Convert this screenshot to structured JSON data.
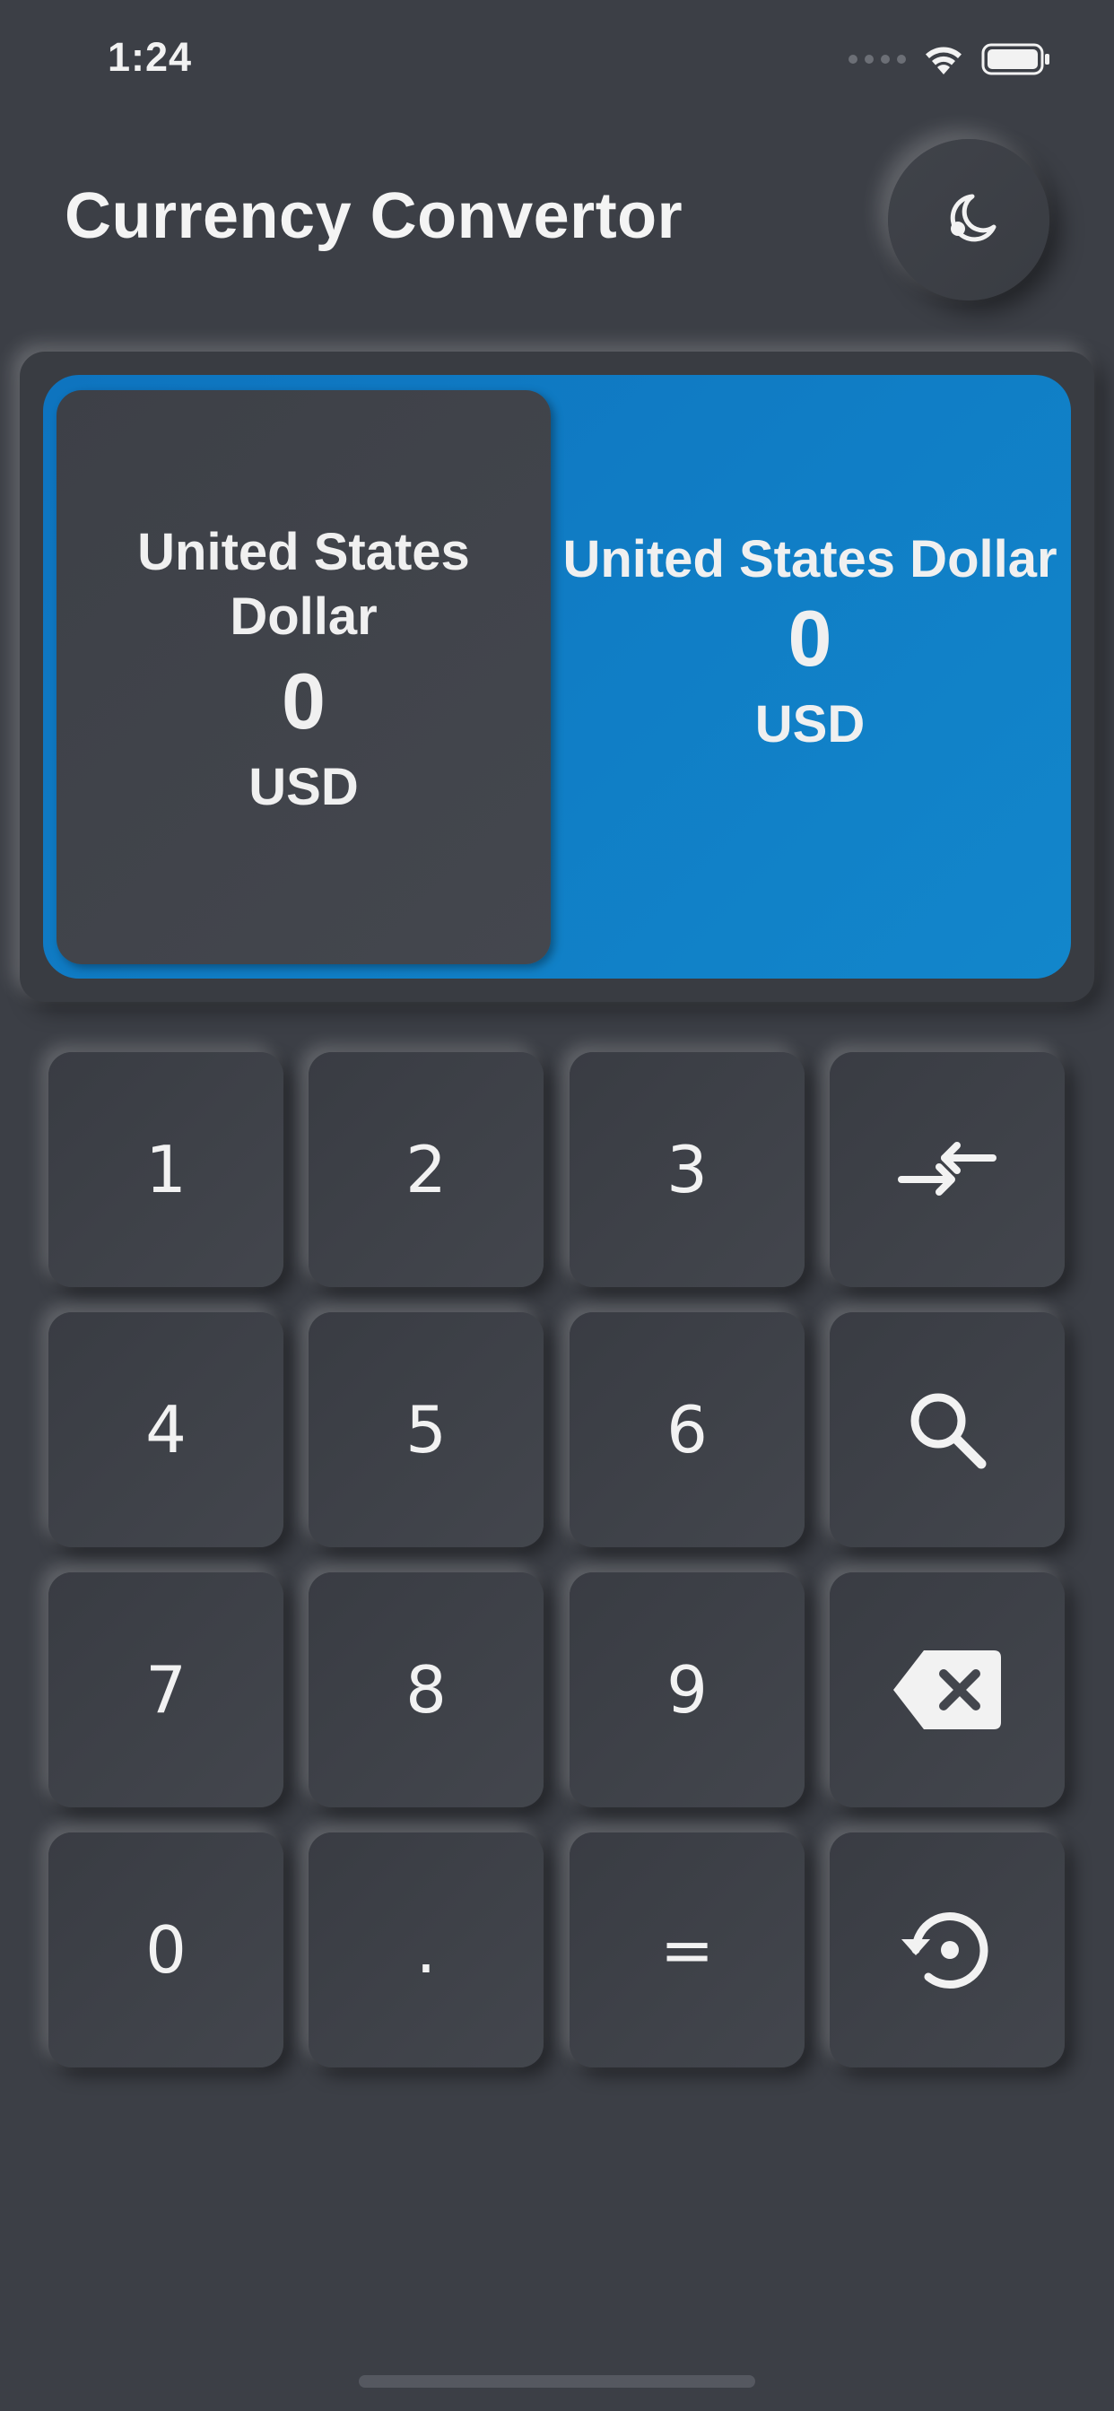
{
  "status_bar": {
    "time": "1:24"
  },
  "header": {
    "title": "Currency Convertor",
    "theme_toggle_icon": "moon-icon"
  },
  "converter": {
    "accent_color": "#1080c8",
    "from": {
      "name": "United States Dollar",
      "amount": "0",
      "code": "USD"
    },
    "to": {
      "name": "United States Dollar",
      "amount": "0",
      "code": "USD"
    }
  },
  "keypad": {
    "keys": [
      {
        "label": "1"
      },
      {
        "label": "2"
      },
      {
        "label": "3"
      },
      {
        "icon": "swap-icon"
      },
      {
        "label": "4"
      },
      {
        "label": "5"
      },
      {
        "label": "6"
      },
      {
        "icon": "search-icon"
      },
      {
        "label": "7"
      },
      {
        "label": "8"
      },
      {
        "label": "9"
      },
      {
        "icon": "backspace-icon"
      },
      {
        "label": "0"
      },
      {
        "label": "."
      },
      {
        "label": "="
      },
      {
        "icon": "history-icon"
      }
    ]
  }
}
